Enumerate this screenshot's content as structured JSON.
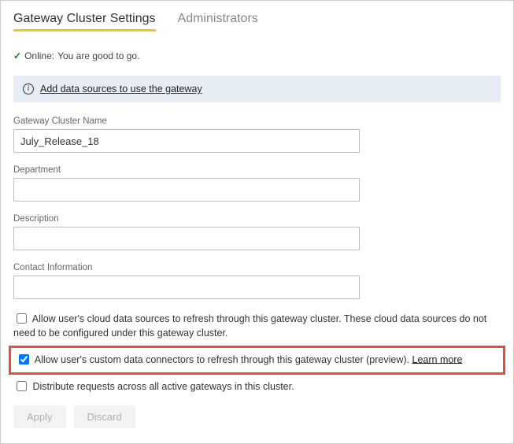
{
  "tabs": {
    "settings": "Gateway Cluster Settings",
    "admins": "Administrators"
  },
  "status": {
    "prefix": "Online:",
    "message": "You are good to go."
  },
  "banner": {
    "link_text": "Add data sources to use the gateway"
  },
  "fields": {
    "cluster_name_label": "Gateway Cluster Name",
    "cluster_name_value": "July_Release_18",
    "department_label": "Department",
    "department_value": "",
    "description_label": "Description",
    "description_value": "",
    "contact_label": "Contact Information",
    "contact_value": ""
  },
  "options": {
    "cloud_sources": "Allow user's cloud data sources to refresh through this gateway cluster. These cloud data sources do not need to be configured under this gateway cluster.",
    "custom_connectors": "Allow user's custom data connectors to refresh through this gateway cluster (preview).",
    "learn_more": "Learn more",
    "distribute": "Distribute requests across all active gateways in this cluster."
  },
  "buttons": {
    "apply": "Apply",
    "discard": "Discard"
  }
}
